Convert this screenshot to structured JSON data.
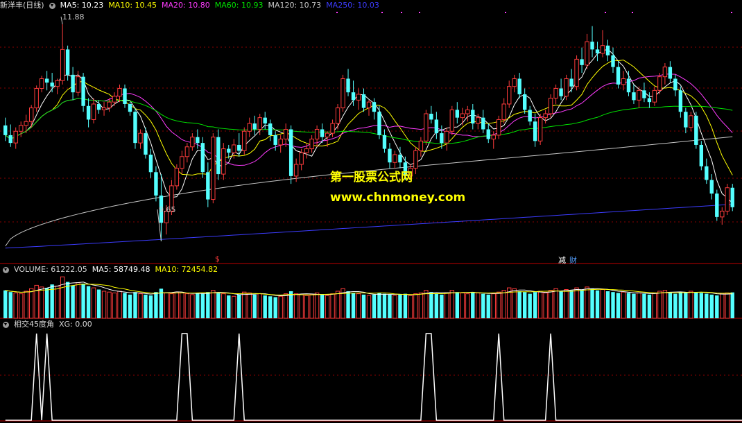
{
  "header": {
    "stock": "新洋丰(日线)",
    "ma5": "MA5: 10.23",
    "ma10": "MA10: 10.45",
    "ma20": "MA20: 10.80",
    "ma60": "MA60: 10.93",
    "ma120": "MA120: 10.73",
    "ma250": "MA250: 10.03"
  },
  "price_labels": {
    "high": "11.88",
    "low": "9.65"
  },
  "markers": {
    "dollar": "$",
    "jian": "减",
    "cai": "财"
  },
  "volume_header": {
    "volume": "VOLUME: 61222.05",
    "ma5": "MA5: 58749.48",
    "ma10": "MA10: 72454.82"
  },
  "indicator_header": {
    "name": "相交45度角",
    "xg": "XG: 0.00"
  },
  "watermark": {
    "line1": "第一股票公式网",
    "line2": "www.chnmoney.com"
  },
  "colors": {
    "up": "#ff3c3c",
    "down": "#54ffff",
    "ma5": "#ffffff",
    "ma10": "#ffff00",
    "ma20": "#ff3cff",
    "ma60": "#00e600",
    "ma120": "#c8c8c8",
    "ma250": "#3c3cff",
    "grid": "#8b0000"
  },
  "chart_data": [
    {
      "type": "candlestick",
      "title": "新洋丰(日线)",
      "ylim": [
        9.55,
        12.0
      ],
      "annotations": {
        "max": 11.88,
        "min": 9.65
      },
      "ohlc": [
        [
          10.84,
          10.92,
          10.68,
          10.74
        ],
        [
          10.74,
          10.85,
          10.62,
          10.66
        ],
        [
          10.66,
          10.82,
          10.6,
          10.78
        ],
        [
          10.78,
          10.88,
          10.72,
          10.84
        ],
        [
          10.84,
          10.95,
          10.76,
          10.88
        ],
        [
          10.88,
          11.05,
          10.82,
          11.02
        ],
        [
          11.02,
          11.25,
          10.98,
          11.22
        ],
        [
          11.22,
          11.35,
          11.18,
          11.32
        ],
        [
          11.32,
          11.4,
          11.2,
          11.28
        ],
        [
          11.28,
          11.38,
          11.18,
          11.24
        ],
        [
          11.24,
          11.32,
          11.16,
          11.3
        ],
        [
          11.3,
          11.88,
          11.26,
          11.62
        ],
        [
          11.62,
          11.66,
          11.3,
          11.36
        ],
        [
          11.36,
          11.44,
          11.1,
          11.18
        ],
        [
          11.18,
          11.4,
          11.14,
          11.34
        ],
        [
          11.34,
          11.38,
          10.98,
          11.04
        ],
        [
          11.04,
          11.12,
          10.82,
          10.9
        ],
        [
          10.9,
          11.12,
          10.86,
          11.06
        ],
        [
          11.06,
          11.1,
          10.96,
          11.0
        ],
        [
          11.0,
          11.08,
          10.94,
          11.02
        ],
        [
          11.02,
          11.12,
          10.98,
          11.08
        ],
        [
          11.08,
          11.18,
          11.04,
          11.14
        ],
        [
          11.14,
          11.26,
          11.08,
          11.22
        ],
        [
          11.22,
          11.26,
          11.02,
          11.06
        ],
        [
          11.06,
          11.08,
          10.94,
          10.98
        ],
        [
          10.98,
          11.02,
          10.6,
          10.66
        ],
        [
          10.66,
          10.8,
          10.6,
          10.76
        ],
        [
          10.76,
          10.82,
          10.5,
          10.54
        ],
        [
          10.54,
          10.6,
          10.3,
          10.36
        ],
        [
          10.36,
          10.42,
          10.06,
          10.12
        ],
        [
          10.12,
          10.34,
          9.65,
          9.84
        ],
        [
          9.84,
          10.02,
          9.72,
          9.96
        ],
        [
          9.96,
          10.28,
          9.92,
          10.22
        ],
        [
          10.22,
          10.44,
          10.18,
          10.4
        ],
        [
          10.4,
          10.58,
          10.34,
          10.52
        ],
        [
          10.52,
          10.66,
          10.46,
          10.62
        ],
        [
          10.62,
          10.76,
          10.58,
          10.72
        ],
        [
          10.72,
          10.8,
          10.6,
          10.66
        ],
        [
          10.66,
          10.72,
          10.3,
          10.36
        ],
        [
          10.36,
          10.46,
          10.0,
          10.08
        ],
        [
          10.08,
          10.76,
          10.04,
          10.72
        ],
        [
          10.72,
          10.8,
          10.28,
          10.34
        ],
        [
          10.34,
          10.66,
          10.28,
          10.6
        ],
        [
          10.6,
          10.64,
          10.5,
          10.56
        ],
        [
          10.56,
          10.7,
          10.5,
          10.64
        ],
        [
          10.64,
          10.76,
          10.52,
          10.58
        ],
        [
          10.58,
          10.82,
          10.54,
          10.78
        ],
        [
          10.78,
          10.92,
          10.72,
          10.86
        ],
        [
          10.86,
          10.94,
          10.74,
          10.8
        ],
        [
          10.8,
          10.96,
          10.74,
          10.92
        ],
        [
          10.92,
          10.98,
          10.8,
          10.86
        ],
        [
          10.86,
          10.9,
          10.68,
          10.74
        ],
        [
          10.74,
          10.78,
          10.58,
          10.64
        ],
        [
          10.64,
          10.74,
          10.56,
          10.7
        ],
        [
          10.7,
          10.86,
          10.62,
          10.8
        ],
        [
          10.8,
          10.84,
          10.24,
          10.32
        ],
        [
          10.32,
          10.5,
          10.26,
          10.44
        ],
        [
          10.44,
          10.6,
          10.38,
          10.56
        ],
        [
          10.56,
          10.66,
          10.5,
          10.6
        ],
        [
          10.6,
          10.74,
          10.56,
          10.7
        ],
        [
          10.7,
          10.84,
          10.62,
          10.8
        ],
        [
          10.8,
          10.86,
          10.66,
          10.72
        ],
        [
          10.72,
          10.78,
          10.62,
          10.76
        ],
        [
          10.76,
          10.9,
          10.72,
          10.86
        ],
        [
          10.86,
          11.06,
          10.8,
          11.02
        ],
        [
          11.02,
          11.36,
          10.98,
          11.32
        ],
        [
          11.32,
          11.42,
          11.14,
          11.18
        ],
        [
          11.18,
          11.3,
          11.04,
          11.1
        ],
        [
          11.1,
          11.22,
          11.0,
          11.16
        ],
        [
          11.16,
          11.22,
          10.98,
          11.02
        ],
        [
          11.02,
          11.1,
          10.94,
          11.08
        ],
        [
          11.08,
          11.12,
          10.9,
          10.98
        ],
        [
          10.98,
          11.04,
          10.7,
          10.74
        ],
        [
          10.74,
          10.8,
          10.56,
          10.6
        ],
        [
          10.6,
          10.66,
          10.4,
          10.46
        ],
        [
          10.46,
          10.58,
          10.4,
          10.54
        ],
        [
          10.54,
          10.62,
          10.4,
          10.46
        ],
        [
          10.46,
          10.52,
          10.28,
          10.32
        ],
        [
          10.32,
          10.44,
          10.28,
          10.4
        ],
        [
          10.4,
          10.62,
          10.34,
          10.58
        ],
        [
          10.58,
          10.72,
          10.52,
          10.68
        ],
        [
          10.68,
          11.0,
          10.64,
          10.96
        ],
        [
          10.96,
          11.04,
          10.86,
          10.9
        ],
        [
          10.9,
          10.98,
          10.7,
          10.76
        ],
        [
          10.76,
          10.84,
          10.6,
          10.66
        ],
        [
          10.66,
          10.82,
          10.58,
          10.78
        ],
        [
          10.78,
          11.04,
          10.74,
          11.0
        ],
        [
          11.0,
          11.08,
          10.86,
          10.92
        ],
        [
          10.92,
          11.02,
          10.84,
          10.96
        ],
        [
          10.96,
          11.04,
          10.88,
          11.0
        ],
        [
          11.0,
          11.06,
          10.8,
          10.86
        ],
        [
          10.86,
          10.96,
          10.8,
          10.92
        ],
        [
          10.92,
          11.0,
          10.76,
          10.8
        ],
        [
          10.8,
          10.86,
          10.66,
          10.7
        ],
        [
          10.7,
          10.78,
          10.6,
          10.74
        ],
        [
          10.74,
          10.94,
          10.7,
          10.9
        ],
        [
          10.9,
          11.12,
          10.86,
          11.06
        ],
        [
          11.06,
          11.3,
          11.02,
          11.24
        ],
        [
          11.24,
          11.36,
          11.18,
          11.32
        ],
        [
          11.32,
          11.38,
          11.12,
          11.16
        ],
        [
          11.16,
          11.22,
          10.96,
          11.0
        ],
        [
          11.0,
          11.04,
          10.84,
          10.88
        ],
        [
          10.88,
          10.96,
          10.62,
          10.68
        ],
        [
          10.68,
          10.96,
          10.64,
          10.92
        ],
        [
          10.92,
          11.0,
          10.86,
          10.96
        ],
        [
          10.96,
          11.16,
          10.92,
          11.12
        ],
        [
          11.12,
          11.26,
          11.06,
          11.22
        ],
        [
          11.22,
          11.32,
          11.1,
          11.14
        ],
        [
          11.14,
          11.36,
          11.1,
          11.32
        ],
        [
          11.32,
          11.42,
          11.18,
          11.24
        ],
        [
          11.24,
          11.56,
          11.2,
          11.52
        ],
        [
          11.52,
          11.64,
          11.38,
          11.46
        ],
        [
          11.46,
          11.78,
          11.42,
          11.7
        ],
        [
          11.7,
          11.86,
          11.54,
          11.62
        ],
        [
          11.62,
          11.7,
          11.5,
          11.58
        ],
        [
          11.58,
          11.82,
          11.54,
          11.66
        ],
        [
          11.66,
          11.72,
          11.5,
          11.56
        ],
        [
          11.56,
          11.64,
          11.38,
          11.44
        ],
        [
          11.44,
          11.5,
          11.22,
          11.26
        ],
        [
          11.26,
          11.4,
          11.2,
          11.32
        ],
        [
          11.32,
          11.4,
          11.14,
          11.18
        ],
        [
          11.18,
          11.26,
          11.06,
          11.1
        ],
        [
          11.1,
          11.24,
          11.02,
          11.2
        ],
        [
          11.2,
          11.28,
          11.08,
          11.12
        ],
        [
          11.12,
          11.18,
          11.02,
          11.08
        ],
        [
          11.08,
          11.24,
          11.04,
          11.2
        ],
        [
          11.2,
          11.38,
          11.16,
          11.34
        ],
        [
          11.34,
          11.48,
          11.26,
          11.44
        ],
        [
          11.44,
          11.5,
          11.28,
          11.32
        ],
        [
          11.32,
          11.36,
          11.14,
          11.2
        ],
        [
          11.2,
          11.24,
          10.92,
          10.98
        ],
        [
          10.98,
          11.02,
          10.76,
          10.82
        ],
        [
          10.82,
          10.98,
          10.78,
          10.94
        ],
        [
          10.94,
          10.98,
          10.6,
          10.64
        ],
        [
          10.64,
          10.68,
          10.38,
          10.42
        ],
        [
          10.42,
          10.5,
          10.24,
          10.28
        ],
        [
          10.28,
          10.34,
          10.08,
          10.14
        ],
        [
          10.14,
          10.18,
          9.86,
          9.9
        ],
        [
          9.9,
          10.0,
          9.82,
          9.96
        ],
        [
          9.96,
          10.24,
          9.92,
          10.2
        ],
        [
          10.2,
          10.24,
          9.96,
          10.0
        ]
      ]
    },
    {
      "type": "bar",
      "title": "VOLUME",
      "values": [
        66000,
        62000,
        60000,
        58000,
        64000,
        70000,
        78000,
        74000,
        72000,
        80000,
        76000,
        98000,
        86000,
        78000,
        84000,
        82000,
        76000,
        72000,
        68000,
        64000,
        62000,
        60000,
        64000,
        60000,
        56000,
        62000,
        58000,
        56000,
        54000,
        62000,
        70000,
        60000,
        58000,
        62000,
        60000,
        58000,
        56000,
        60000,
        58000,
        62000,
        66000,
        60000,
        58000,
        54000,
        52000,
        56000,
        62000,
        60000,
        56000,
        58000,
        54000,
        52000,
        50000,
        52000,
        58000,
        64000,
        58000,
        56000,
        54000,
        56000,
        60000,
        56000,
        54000,
        58000,
        64000,
        70000,
        64000,
        60000,
        58000,
        56000,
        54000,
        56000,
        60000,
        58000,
        56000,
        54000,
        56000,
        58000,
        54000,
        58000,
        60000,
        66000,
        62000,
        58000,
        56000,
        60000,
        66000,
        62000,
        60000,
        58000,
        62000,
        60000,
        58000,
        56000,
        58000,
        62000,
        66000,
        72000,
        70000,
        64000,
        62000,
        58000,
        62000,
        64000,
        60000,
        66000,
        70000,
        64000,
        68000,
        66000,
        72000,
        68000,
        74000,
        70000,
        66000,
        68000,
        64000,
        62000,
        60000,
        62000,
        60000,
        58000,
        60000,
        58000,
        56000,
        60000,
        64000,
        66000,
        62000,
        58000,
        62000,
        60000,
        64000,
        62000,
        60000,
        58000,
        56000,
        54000,
        58000,
        60000,
        61222
      ],
      "ma5_last": 58749.48,
      "ma10_last": 72454.82
    },
    {
      "type": "line",
      "title": "相交45度角",
      "values": [
        0,
        0,
        0,
        0,
        0,
        0,
        1,
        0,
        1,
        0,
        0,
        0,
        0,
        0,
        0,
        0,
        0,
        0,
        0,
        0,
        0,
        0,
        0,
        0,
        0,
        0,
        0,
        0,
        0,
        0,
        0,
        0,
        0,
        0,
        1,
        1,
        0,
        0,
        0,
        0,
        0,
        0,
        0,
        0,
        0,
        1,
        0,
        0,
        0,
        0,
        0,
        0,
        0,
        0,
        0,
        0,
        0,
        0,
        0,
        0,
        0,
        0,
        0,
        0,
        0,
        0,
        0,
        0,
        0,
        0,
        0,
        0,
        0,
        0,
        0,
        0,
        0,
        0,
        0,
        0,
        0,
        1,
        1,
        0,
        0,
        0,
        0,
        0,
        0,
        0,
        0,
        0,
        0,
        0,
        0,
        1,
        0,
        0,
        0,
        0,
        0,
        0,
        0,
        0,
        0,
        1,
        0,
        0,
        0,
        0,
        0,
        0,
        0,
        0,
        0,
        0,
        0,
        0,
        0,
        0,
        0,
        0,
        0,
        0,
        0,
        0,
        0,
        0,
        0,
        0,
        0,
        0,
        0,
        0,
        0,
        0,
        0,
        0,
        0,
        0,
        0,
        0,
        0,
        0,
        0,
        0,
        0,
        0,
        0,
        0,
        0,
        0,
        0,
        0,
        0,
        0,
        0,
        0,
        0,
        0,
        0
      ]
    }
  ]
}
